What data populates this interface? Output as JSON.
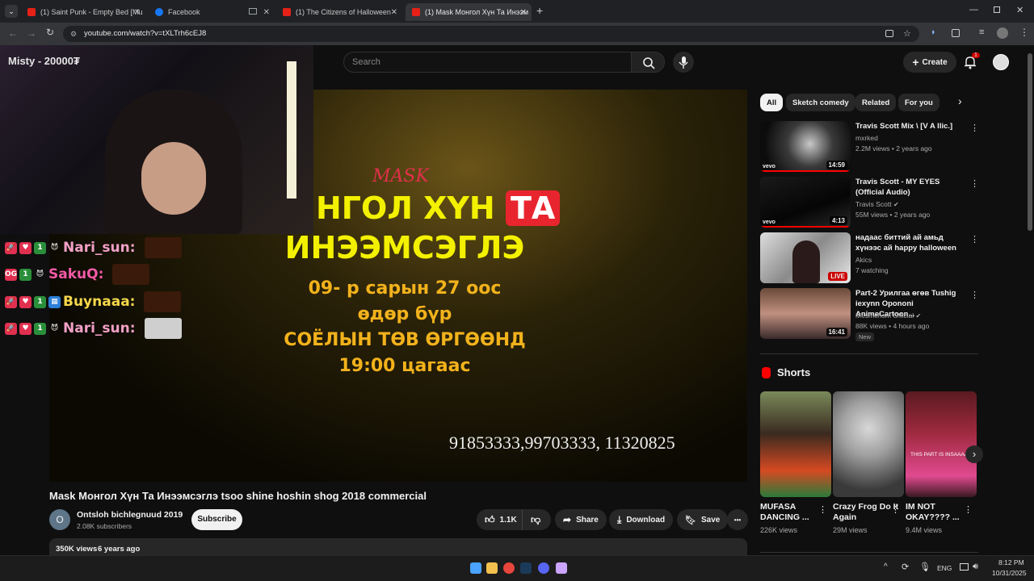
{
  "browser": {
    "tabs": [
      {
        "label": "(1) Saint Punk - Empty Bed [Mu",
        "active": false
      },
      {
        "label": "Facebook",
        "active": false
      },
      {
        "label": "",
        "active": false
      },
      {
        "label": "(1) The Citizens of Halloween -",
        "active": false
      },
      {
        "label": "(1) Mask Монгол Хүн Та Инээм",
        "active": true
      }
    ],
    "new_tab": "+",
    "url": "youtube.com/watch?v=tXLTrh6cEJ8"
  },
  "youtube": {
    "search_placeholder": "Search",
    "create_label": "Create",
    "notif_count": "1",
    "stream_overlay": {
      "webcam_label": "Misty - 20000₮",
      "chat": [
        {
          "user": "Nari_sun:"
        },
        {
          "user": "SakuQ:"
        },
        {
          "user": "Buynaaa:"
        },
        {
          "user": "Nari_sun:"
        }
      ]
    },
    "video_frame": {
      "logo_text": "MASK",
      "line1a": "НГОЛ ХҮН",
      "line1b": "ТА",
      "line2": "ИНЭЭМСЭГЛЭ",
      "line3": "09- р сарын 27 оос",
      "line4": "өдөр бүр",
      "line5": "СОЁЛЫН ТӨВ ӨРГӨӨНД",
      "line6": "19:00 цагаас",
      "phones": "91853333,99703333, 11320825"
    },
    "title": "Mask Монгол Хүн Та Инээмсэглэ tsoo shine hoshin shog 2018 commercial",
    "channel": {
      "avatar_letter": "O",
      "name": "Ontsloh bichlegnuud 2019",
      "subs": "2.08K subscribers",
      "subscribe": "Subscribe"
    },
    "actions": {
      "likes": "1.1K",
      "share": "Share",
      "download": "Download",
      "save": "Save",
      "more": "•••"
    },
    "description": {
      "views": "350K views",
      "age": "6 years ago"
    },
    "chips": [
      "All",
      "Sketch comedy",
      "Related",
      "For you"
    ],
    "recommendations": [
      {
        "title": "Travis Scott Mix \\ [V A llic.]",
        "channel": "mxrked",
        "meta": "2.2M views • 2 years ago",
        "duration": "14:59",
        "badge": "vevo"
      },
      {
        "title": "Travis Scott - MY EYES (Official Audio)",
        "channel": "Travis Scott",
        "meta": "55M views • 2 years ago",
        "duration": "4:13",
        "badge": "vevo"
      },
      {
        "title": "надаас биттий ай амьд хүнээс ай happy halloween",
        "channel": "Akics",
        "meta": "7 watching",
        "duration": "LIVE",
        "badge": ""
      },
      {
        "title": "Part-2 Урилгаа өгөв Tushig iexynn Opononi AnimeCartoon...",
        "channel": "Mesmerism Official",
        "meta": "88K views • 4 hours ago",
        "duration": "16:41",
        "badge": "New"
      }
    ],
    "shorts_heading": "Shorts",
    "shorts": [
      {
        "title": "MUFASA DANCING ...",
        "views": "226K views"
      },
      {
        "title": "Crazy Frog Do It Again",
        "views": "29M views"
      },
      {
        "title": "IM NOT OKAY???? ...",
        "views": "9.4M views",
        "overlay": "THIS PART IS INSAAAA"
      }
    ]
  },
  "taskbar": {
    "lang": "ENG",
    "time": "8:12 PM",
    "date": "10/31/2025"
  }
}
